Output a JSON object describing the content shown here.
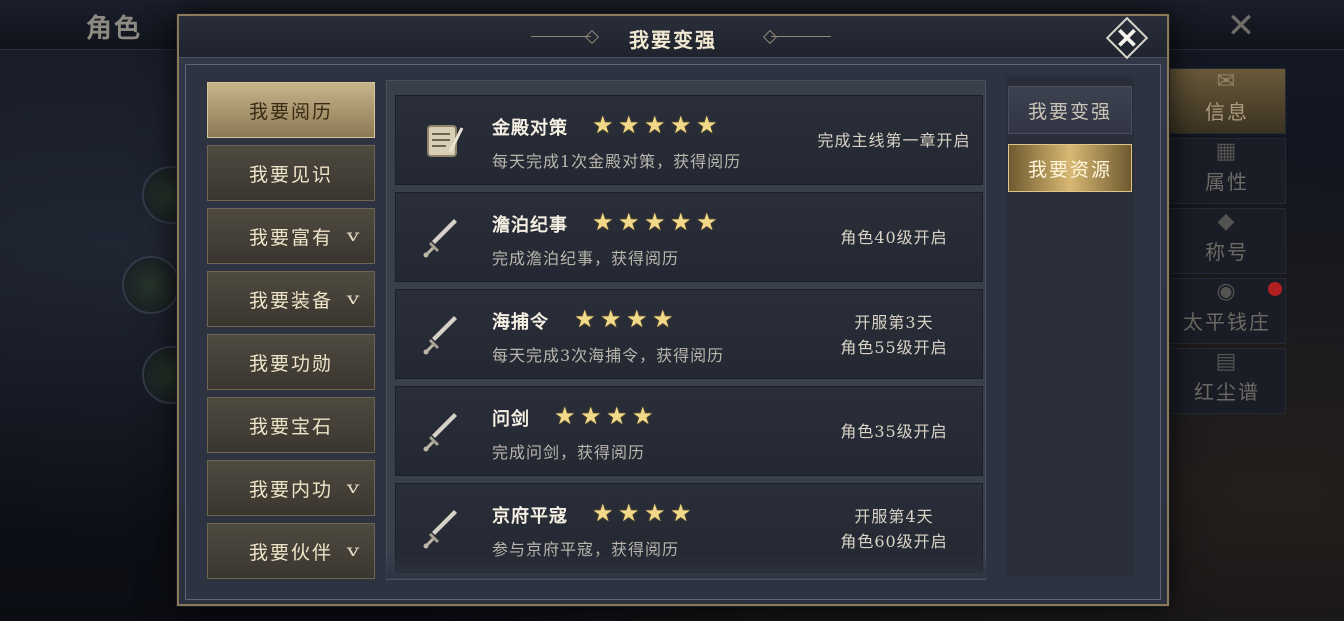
{
  "background": {
    "title": "角色",
    "right_menu": [
      {
        "label": "信息",
        "icon": "scroll-icon",
        "active": true
      },
      {
        "label": "属性",
        "icon": "chart-icon",
        "active": false
      },
      {
        "label": "称号",
        "icon": "badge-icon",
        "active": false
      },
      {
        "label": "太平钱庄",
        "icon": "coin-icon",
        "active": false
      },
      {
        "label": "红尘谱",
        "icon": "book-icon",
        "active": false
      }
    ]
  },
  "dialog": {
    "title": "我要变强",
    "close_label": "✕"
  },
  "left_tabs": [
    {
      "label": "我要阅历",
      "active": true,
      "has_chevron": false
    },
    {
      "label": "我要见识",
      "active": false,
      "has_chevron": false
    },
    {
      "label": "我要富有",
      "active": false,
      "has_chevron": true
    },
    {
      "label": "我要装备",
      "active": false,
      "has_chevron": true
    },
    {
      "label": "我要功勋",
      "active": false,
      "has_chevron": false
    },
    {
      "label": "我要宝石",
      "active": false,
      "has_chevron": false
    },
    {
      "label": "我要内功",
      "active": false,
      "has_chevron": true
    },
    {
      "label": "我要伙伴",
      "active": false,
      "has_chevron": true
    }
  ],
  "right_tabs": [
    {
      "label": "我要变强",
      "active": false
    },
    {
      "label": "我要资源",
      "active": true
    }
  ],
  "items": [
    {
      "name": "金殿对策",
      "stars": 5,
      "icon": "scroll-quill-icon",
      "desc": "每天完成1次金殿对策，获得阅历",
      "cond": [
        "完成主线第一章开启"
      ]
    },
    {
      "name": "澹泊纪事",
      "stars": 5,
      "icon": "sword-icon",
      "desc": "完成澹泊纪事，获得阅历",
      "cond": [
        "角色40级开启"
      ]
    },
    {
      "name": "海捕令",
      "stars": 4,
      "icon": "sword-icon",
      "desc": "每天完成3次海捕令，获得阅历",
      "cond": [
        "开服第3天",
        "角色55级开启"
      ]
    },
    {
      "name": "问剑",
      "stars": 4,
      "icon": "sword-icon",
      "desc": "完成问剑，获得阅历",
      "cond": [
        "角色35级开启"
      ]
    },
    {
      "name": "京府平寇",
      "stars": 4,
      "icon": "sword-icon",
      "desc": "参与京府平寇，获得阅历",
      "cond": [
        "开服第4天",
        "角色60级开启"
      ]
    }
  ]
}
